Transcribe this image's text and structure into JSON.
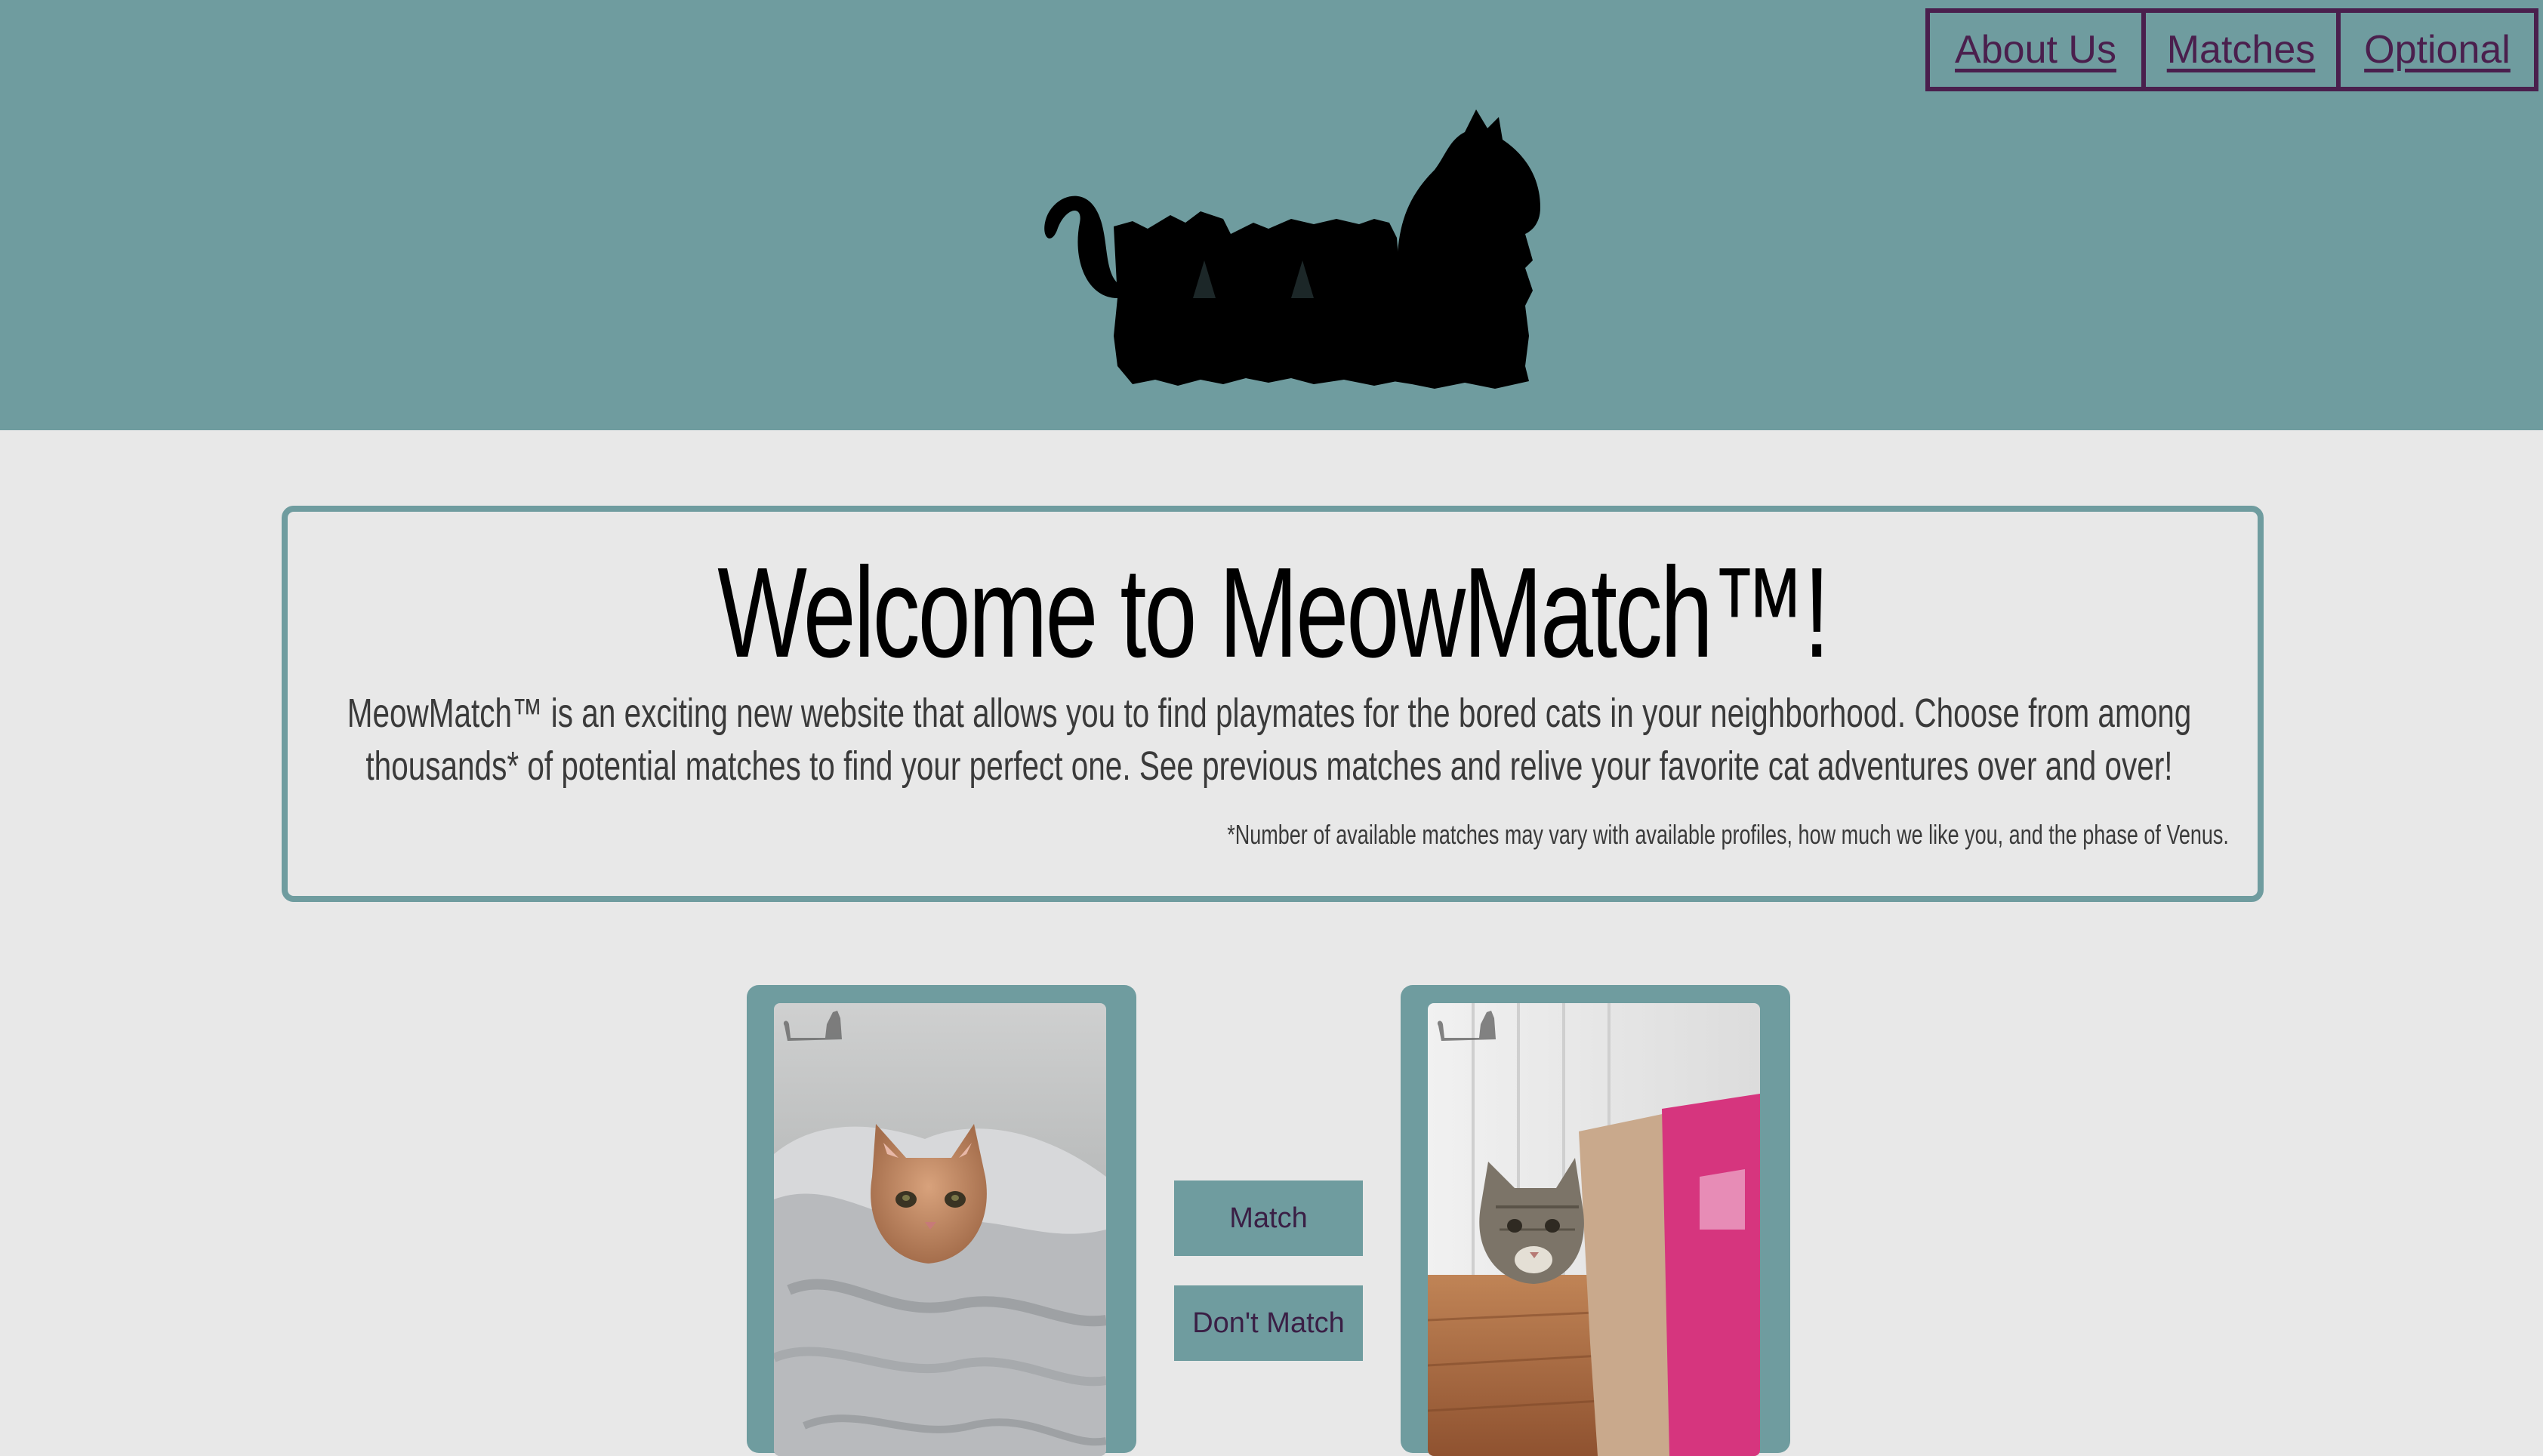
{
  "nav": {
    "items": [
      {
        "label": "About Us"
      },
      {
        "label": "Matches"
      },
      {
        "label": "Optional"
      }
    ]
  },
  "logo": {
    "icon": "cat-silhouette-logo-icon"
  },
  "welcome": {
    "title": "Welcome to MeowMatch™!",
    "body": "MeowMatch™ is an exciting new website that allows you to find playmates for the bored cats in your neighborhood. Choose from among thousands* of potential matches to find your perfect one. See previous matches and relive your favorite cat adventures over and over!",
    "footnote": "*Number of available matches may vary with available profiles, how much we like you, and the phase of Venus."
  },
  "cards": [
    {
      "photo": "orange tabby cat wrapped in a gray blanket"
    },
    {
      "photo": "tabby cat peeking out of a paper bag"
    }
  ],
  "actions": {
    "match_label": "Match",
    "dont_match_label": "Don't Match"
  },
  "colors": {
    "header": "#6f9c9f",
    "accent": "#4a1f4d",
    "background": "#e8e8e8"
  }
}
